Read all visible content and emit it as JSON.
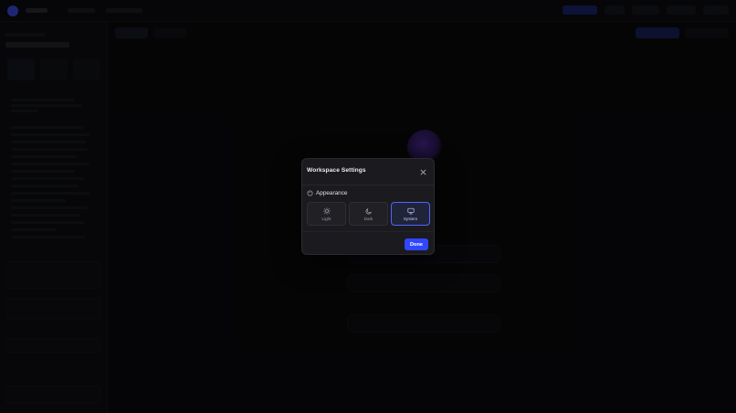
{
  "modal": {
    "title": "Workspace Settings",
    "section_label": "Appearance",
    "options": [
      {
        "label": "Light",
        "icon": "sun-icon",
        "selected": false
      },
      {
        "label": "Dark",
        "icon": "moon-icon",
        "selected": false
      },
      {
        "label": "System",
        "icon": "monitor-icon",
        "selected": true
      }
    ],
    "done_label": "Done"
  },
  "colors": {
    "accent": "#3047ff",
    "overlay": "rgba(0,0,0,0.55)",
    "modal_bg": "#1b1b1f"
  }
}
